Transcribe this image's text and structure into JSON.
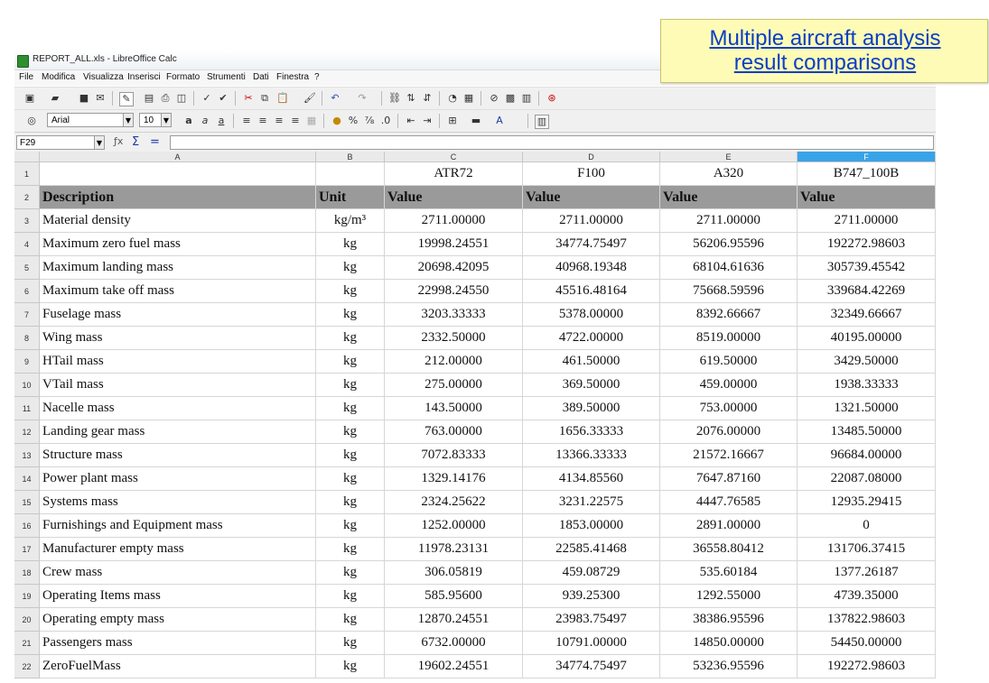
{
  "window": {
    "title": "REPORT_ALL.xls - LibreOffice Calc"
  },
  "menu": [
    "File",
    "Modifica",
    "Visualizza",
    "Inserisci",
    "Formato",
    "Strumenti",
    "Dati",
    "Finestra",
    "?"
  ],
  "format_toolbar": {
    "font_name": "Arial",
    "font_size": "10"
  },
  "formula_bar": {
    "cell_ref": "F29",
    "content": ""
  },
  "columns": [
    "A",
    "B",
    "C",
    "D",
    "E",
    "F"
  ],
  "selected_column": "F",
  "callout": {
    "line1": "Multiple aircraft analysis",
    "line2": "result comparisons"
  },
  "rows": [
    {
      "n": "1",
      "a": "",
      "b": "",
      "c": "ATR72",
      "d": "F100",
      "e": "A320",
      "f": "B747_100B"
    },
    {
      "n": "2",
      "a": "Description",
      "b": "Unit",
      "c": "Value",
      "d": "Value",
      "e": "Value",
      "f": "Value"
    },
    {
      "n": "3",
      "a": "Material density",
      "b": "kg/m³",
      "c": "2711.00000",
      "d": "2711.00000",
      "e": "2711.00000",
      "f": "2711.00000"
    },
    {
      "n": "4",
      "a": "Maximum zero fuel mass",
      "b": "kg",
      "c": "19998.24551",
      "d": "34774.75497",
      "e": "56206.95596",
      "f": "192272.98603"
    },
    {
      "n": "5",
      "a": "Maximum landing mass",
      "b": "kg",
      "c": "20698.42095",
      "d": "40968.19348",
      "e": "68104.61636",
      "f": "305739.45542"
    },
    {
      "n": "6",
      "a": "Maximum take off mass",
      "b": "kg",
      "c": "22998.24550",
      "d": "45516.48164",
      "e": "75668.59596",
      "f": "339684.42269"
    },
    {
      "n": "7",
      "a": "Fuselage mass",
      "b": "kg",
      "c": "3203.33333",
      "d": "5378.00000",
      "e": "8392.66667",
      "f": "32349.66667"
    },
    {
      "n": "8",
      "a": "Wing mass",
      "b": "kg",
      "c": "2332.50000",
      "d": "4722.00000",
      "e": "8519.00000",
      "f": "40195.00000"
    },
    {
      "n": "9",
      "a": "HTail mass",
      "b": "kg",
      "c": "212.00000",
      "d": "461.50000",
      "e": "619.50000",
      "f": "3429.50000"
    },
    {
      "n": "10",
      "a": "VTail mass",
      "b": "kg",
      "c": "275.00000",
      "d": "369.50000",
      "e": "459.00000",
      "f": "1938.33333"
    },
    {
      "n": "11",
      "a": "Nacelle mass",
      "b": "kg",
      "c": "143.50000",
      "d": "389.50000",
      "e": "753.00000",
      "f": "1321.50000"
    },
    {
      "n": "12",
      "a": "Landing gear mass",
      "b": "kg",
      "c": "763.00000",
      "d": "1656.33333",
      "e": "2076.00000",
      "f": "13485.50000"
    },
    {
      "n": "13",
      "a": "Structure mass",
      "b": "kg",
      "c": "7072.83333",
      "d": "13366.33333",
      "e": "21572.16667",
      "f": "96684.00000"
    },
    {
      "n": "14",
      "a": "Power plant mass",
      "b": "kg",
      "c": "1329.14176",
      "d": "4134.85560",
      "e": "7647.87160",
      "f": "22087.08000"
    },
    {
      "n": "15",
      "a": "Systems mass",
      "b": "kg",
      "c": "2324.25622",
      "d": "3231.22575",
      "e": "4447.76585",
      "f": "12935.29415"
    },
    {
      "n": "16",
      "a": "Furnishings and Equipment mass",
      "b": "kg",
      "c": "1252.00000",
      "d": "1853.00000",
      "e": "2891.00000",
      "f": "0"
    },
    {
      "n": "17",
      "a": "Manufacturer empty mass",
      "b": "kg",
      "c": "11978.23131",
      "d": "22585.41468",
      "e": "36558.80412",
      "f": "131706.37415"
    },
    {
      "n": "18",
      "a": "Crew mass",
      "b": "kg",
      "c": "306.05819",
      "d": "459.08729",
      "e": "535.60184",
      "f": "1377.26187"
    },
    {
      "n": "19",
      "a": "Operating Items mass",
      "b": "kg",
      "c": "585.95600",
      "d": "939.25300",
      "e": "1292.55000",
      "f": "4739.35000"
    },
    {
      "n": "20",
      "a": "Operating empty mass",
      "b": "kg",
      "c": "12870.24551",
      "d": "23983.75497",
      "e": "38386.95596",
      "f": "137822.98603"
    },
    {
      "n": "21",
      "a": "Passengers mass",
      "b": "kg",
      "c": "6732.00000",
      "d": "10791.00000",
      "e": "14850.00000",
      "f": "54450.00000"
    },
    {
      "n": "22",
      "a": "ZeroFuelMass",
      "b": "kg",
      "c": "19602.24551",
      "d": "34774.75497",
      "e": "53236.95596",
      "f": "192272.98603"
    }
  ]
}
